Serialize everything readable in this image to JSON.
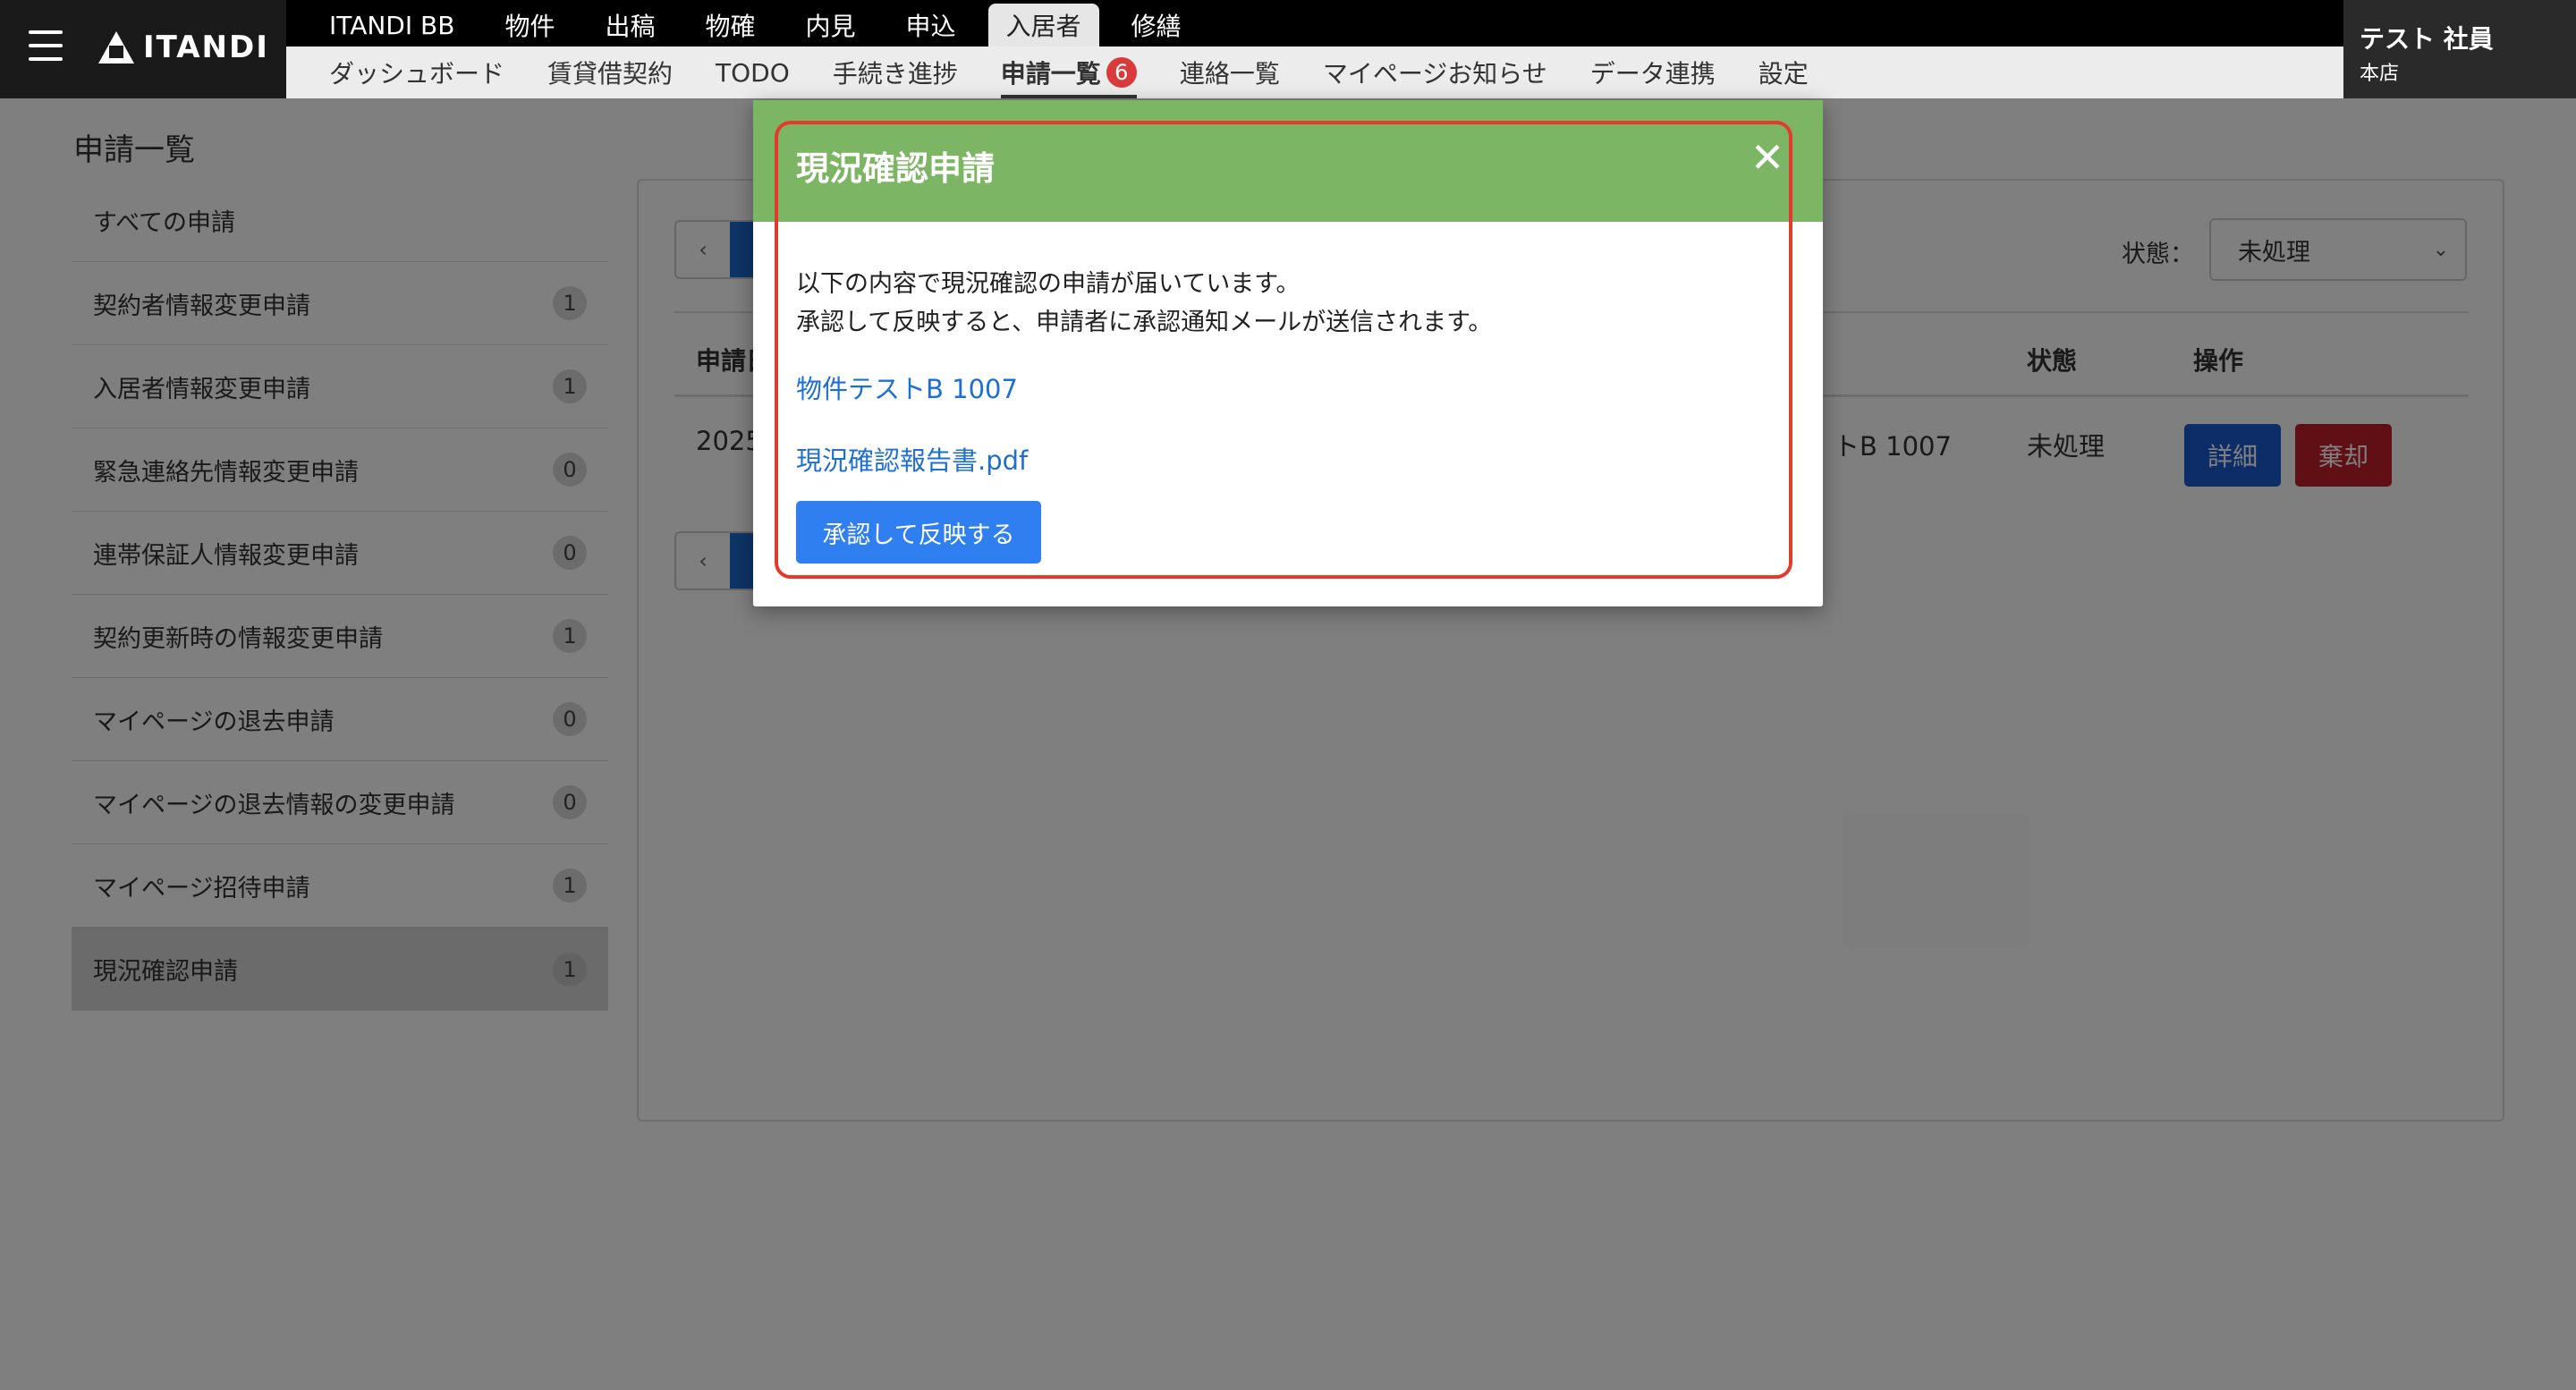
{
  "app": {
    "logo_text": "ITANDI",
    "user_name": "テスト 社員",
    "user_branch": "本店"
  },
  "nav": {
    "main": [
      "ITANDI BB",
      "物件",
      "出稿",
      "物確",
      "内見",
      "申込",
      "入居者",
      "修繕"
    ],
    "main_active": "入居者",
    "sub": [
      "ダッシュボード",
      "賃貸借契約",
      "TODO",
      "手続き進捗",
      "申請一覧",
      "連絡一覧",
      "マイページお知らせ",
      "データ連携",
      "設定"
    ],
    "sub_active": "申請一覧",
    "sub_badge": "6"
  },
  "page": {
    "title": "申請一覧"
  },
  "sidebar": {
    "items": [
      {
        "label": "すべての申請",
        "count": ""
      },
      {
        "label": "契約者情報変更申請",
        "count": "1"
      },
      {
        "label": "入居者情報変更申請",
        "count": "1"
      },
      {
        "label": "緊急連絡先情報変更申請",
        "count": "0"
      },
      {
        "label": "連帯保証人情報変更申請",
        "count": "0"
      },
      {
        "label": "契約更新時の情報変更申請",
        "count": "1"
      },
      {
        "label": "マイページの退去申請",
        "count": "0"
      },
      {
        "label": "マイページの退去情報の変更申請",
        "count": "0"
      },
      {
        "label": "マイページ招待申請",
        "count": "1"
      },
      {
        "label": "現況確認申請",
        "count": "1"
      }
    ],
    "active_index": 9
  },
  "filters": {
    "status_label": "状態：",
    "status_value": "未処理"
  },
  "pager": {
    "prev": "‹"
  },
  "table": {
    "headers": {
      "col1": "申請日",
      "status": "状態",
      "actions": "操作"
    },
    "rows": [
      {
        "date": "2025",
        "property": "トB 1007",
        "status": "未処理",
        "detail_label": "詳細",
        "reject_label": "棄却"
      }
    ]
  },
  "modal": {
    "title": "現況確認申請",
    "close_icon": "close-icon",
    "message_line1": "以下の内容で現況確認の申請が届いています。",
    "message_line2": "承認して反映すると、申請者に承認通知メールが送信されます。",
    "property_link": "物件テストB 1007",
    "file_link": "現況確認報告書.pdf",
    "approve_label": "承認して反映する"
  },
  "colors": {
    "modal_header": "#7cb563",
    "primary_button": "#2f7ff0",
    "detail_button": "#1a5bd0",
    "reject_button": "#c0212b",
    "highlight_border": "#e23b2e",
    "link": "#1f6fd1"
  }
}
